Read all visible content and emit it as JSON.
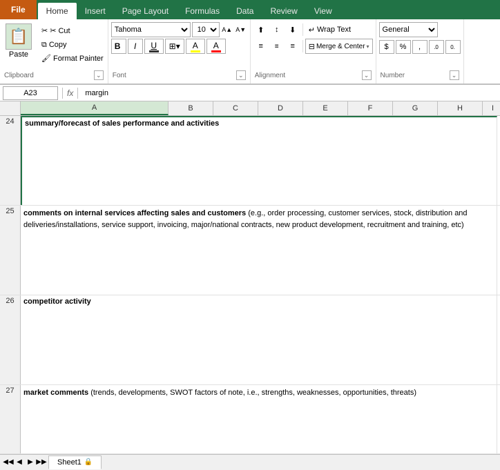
{
  "tabs": {
    "file": "File",
    "home": "Home",
    "insert": "Insert",
    "page_layout": "Page Layout",
    "formulas": "Formulas",
    "data": "Data",
    "review": "Review",
    "view": "View"
  },
  "clipboard": {
    "paste_label": "Paste",
    "cut_label": "✂ Cut",
    "copy_label": "Copy",
    "format_painter_label": "Format Painter",
    "group_label": "Clipboard"
  },
  "font": {
    "font_name": "Tahoma",
    "font_size": "10",
    "group_label": "Font",
    "bold": "B",
    "italic": "I",
    "underline": "U"
  },
  "alignment": {
    "group_label": "Alignment",
    "wrap_text": "Wrap Text",
    "merge_center": "Merge & Center"
  },
  "number": {
    "format": "General",
    "group_label": "Number"
  },
  "formula_bar": {
    "cell_ref": "A23",
    "fx": "fx",
    "formula": "margin"
  },
  "columns": [
    "A",
    "B",
    "C",
    "D",
    "E",
    "F",
    "G",
    "H",
    "I"
  ],
  "rows": [
    {
      "num": "24",
      "content": "summary/forecast of sales performance and activities",
      "bold_part": "summary/forecast of sales performance and activities",
      "plain_part": ""
    },
    {
      "num": "25",
      "content": "comments on internal services affecting sales and customers (e.g., order processing, customer services, stock, distribution and deliveries/installations, service support, invoicing, major/national contracts, new product development, recruitment and training, etc)",
      "bold_part": "comments on internal services affecting sales and customers",
      "plain_part": " (e.g., order processing, customer services, stock, distribution and deliveries/installations, service support, invoicing, major/national contracts, new product development, recruitment and training, etc)"
    },
    {
      "num": "26",
      "content": "competitor activity",
      "bold_part": "competitor activity",
      "plain_part": ""
    },
    {
      "num": "27",
      "content": "market comments (trends, developments, SWOT factors of note, i.e., strengths, weaknesses, opportunities, threats)",
      "bold_part": "market comments",
      "plain_part": " (trends, developments, SWOT factors of note, i.e., strengths, weaknesses, opportunities, threats)"
    }
  ],
  "sheet_tabs": [
    "Sheet1"
  ],
  "icons": {
    "cut": "✂",
    "copy": "⧉",
    "format_painter": "🖌",
    "bold": "B",
    "italic": "I",
    "underline": "U",
    "increase_font": "A▲",
    "decrease_font": "A▼",
    "borders": "⊞",
    "fill_color": "A",
    "font_color": "A",
    "align_left": "≡",
    "align_center": "≡",
    "align_right": "≡",
    "wrap_text": "↵",
    "merge": "⊟",
    "dollar": "$",
    "percent": "%",
    "comma": ",",
    "inc_decimal": ".0",
    "dec_decimal": "0.",
    "expand": "⌄"
  }
}
